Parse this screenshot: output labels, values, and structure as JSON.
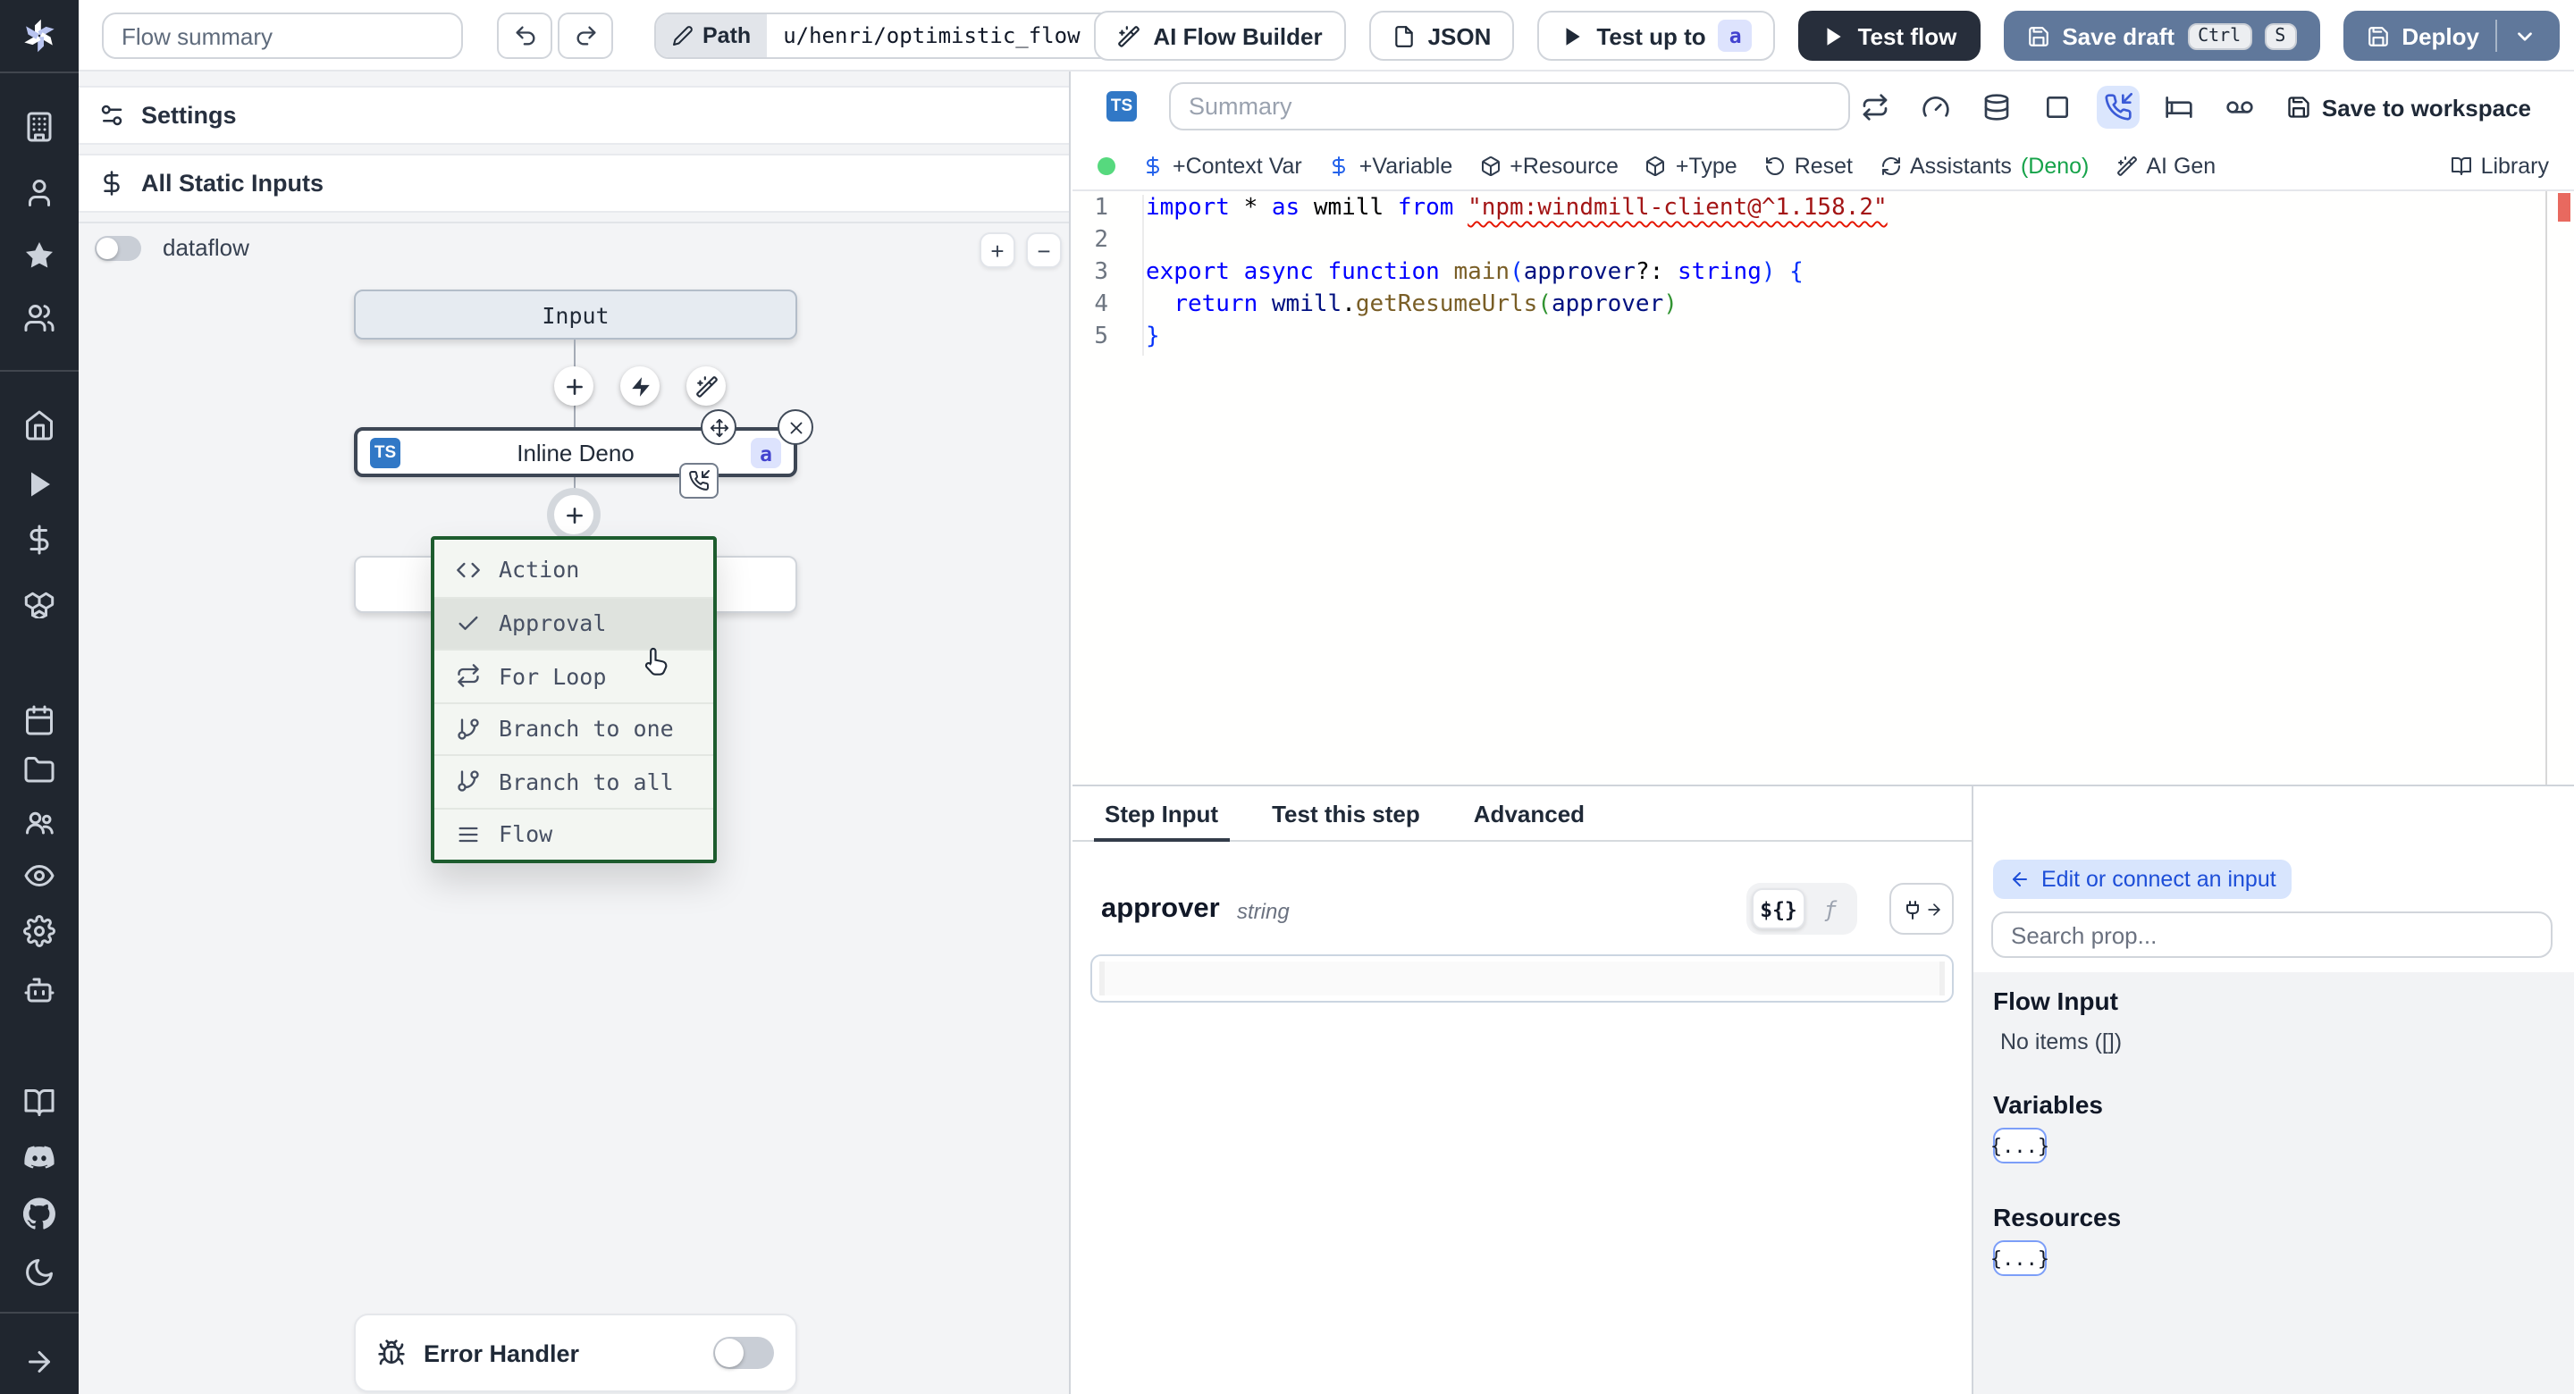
{
  "topbar": {
    "flow_summary_placeholder": "Flow summary",
    "path_label": "Path",
    "path_value": "u/henri/optimistic_flow",
    "ai_flow_builder_label": "AI Flow Builder",
    "json_label": "JSON",
    "test_up_to_label": "Test up to",
    "test_up_to_badge": "a",
    "test_flow_label": "Test flow",
    "save_draft_label": "Save draft",
    "save_draft_kbd": [
      "Ctrl",
      "S"
    ],
    "deploy_label": "Deploy"
  },
  "sidebar": {
    "icons": [
      "windmill-logo",
      "building",
      "user",
      "star",
      "users",
      "home",
      "play",
      "dollar-sign",
      "boxes",
      "calendar",
      "folder",
      "user-group",
      "eye",
      "settings-gear",
      "bot",
      "book-open",
      "discord",
      "github",
      "moon",
      "arrow-right"
    ]
  },
  "flow_panel": {
    "settings_label": "Settings",
    "all_static_inputs_label": "All Static Inputs",
    "dataflow_label": "dataflow",
    "zoom_in": "+",
    "zoom_out": "−",
    "input_node_label": "Input",
    "step_node_label": "Inline Deno",
    "step_node_lang": "TS",
    "step_node_badge": "a",
    "insert_menu": {
      "items": [
        {
          "icon": "code",
          "label": "Action"
        },
        {
          "icon": "check",
          "label": "Approval",
          "highlighted": true
        },
        {
          "icon": "repeat",
          "label": "For Loop"
        },
        {
          "icon": "git-branch",
          "label": "Branch to one"
        },
        {
          "icon": "git-branch",
          "label": "Branch to all"
        },
        {
          "icon": "menu-lines",
          "label": "Flow"
        }
      ]
    },
    "error_handler_label": "Error Handler"
  },
  "editor": {
    "lang_badge": "TS",
    "summary_placeholder": "Summary",
    "save_to_workspace_label": "Save to workspace",
    "status_dot_color": "#56d97e",
    "actions": [
      {
        "icon": "dollar-sign",
        "label": "+Context Var"
      },
      {
        "icon": "dollar-sign",
        "label": "+Variable"
      },
      {
        "icon": "package",
        "label": "+Resource"
      },
      {
        "icon": "package",
        "label": "+Type"
      },
      {
        "icon": "rotate-ccw",
        "label": "Reset"
      },
      {
        "icon": "refresh-cw",
        "label": "Assistants"
      },
      {
        "icon": "wand-sparkles",
        "label": "AI Gen"
      }
    ],
    "assistants_lang": "(Deno)",
    "library_label": "Library",
    "line_numbers": [
      "1",
      "2",
      "3",
      "4",
      "5"
    ],
    "lines": [
      [
        {
          "t": "import",
          "c": "k"
        },
        {
          "t": " * ",
          "c": "d"
        },
        {
          "t": "as",
          "c": "k"
        },
        {
          "t": " wmill ",
          "c": "d"
        },
        {
          "t": "from",
          "c": "k"
        },
        {
          "t": " ",
          "c": "d"
        },
        {
          "t": "\"npm:windmill-client@^1.158.2\"",
          "c": "s e"
        }
      ],
      [],
      [
        {
          "t": "export",
          "c": "k"
        },
        {
          "t": " ",
          "c": "d"
        },
        {
          "t": "async",
          "c": "k"
        },
        {
          "t": " ",
          "c": "d"
        },
        {
          "t": "function",
          "c": "k"
        },
        {
          "t": " ",
          "c": "d"
        },
        {
          "t": "main",
          "c": "f"
        },
        {
          "t": "(",
          "c": "pb"
        },
        {
          "t": "approver",
          "c": "i"
        },
        {
          "t": "?: ",
          "c": "d"
        },
        {
          "t": "string",
          "c": "k"
        },
        {
          "t": ")",
          "c": "pb"
        },
        {
          "t": " {",
          "c": "pb"
        }
      ],
      [
        {
          "t": "  ",
          "c": "d"
        },
        {
          "t": "return",
          "c": "k"
        },
        {
          "t": " wmill",
          "c": "i"
        },
        {
          "t": ".",
          "c": "d"
        },
        {
          "t": "getResumeUrls",
          "c": "f"
        },
        {
          "t": "(",
          "c": "pg"
        },
        {
          "t": "approver",
          "c": "i"
        },
        {
          "t": ")",
          "c": "pg"
        }
      ],
      [
        {
          "t": "}",
          "c": "pb"
        }
      ]
    ]
  },
  "step_panel": {
    "tabs": [
      "Step Input",
      "Test this step",
      "Advanced"
    ],
    "active_tab": "Step Input",
    "field_name": "approver",
    "field_type": "string",
    "template_toggle": "${}",
    "fn_toggle": "ƒ"
  },
  "props_panel": {
    "edit_button_label": "Edit or connect an input",
    "search_placeholder": "Search prop...",
    "flow_input_label": "Flow Input",
    "flow_input_empty": "No items ([])",
    "variables_label": "Variables",
    "resources_label": "Resources",
    "object_chip": "{...}"
  },
  "colors": {
    "steel_button": "#60789b",
    "dark_button": "#272e3b",
    "menu_border": "#1d5c2e",
    "ts_badge_blue": "#3178c6",
    "suspend_active_bg": "#dbe6fd",
    "deno_green": "#16a34a",
    "error_marker": "#e8695f",
    "status_dot": "#56d97e",
    "sidebar_bg": "#20262f"
  }
}
